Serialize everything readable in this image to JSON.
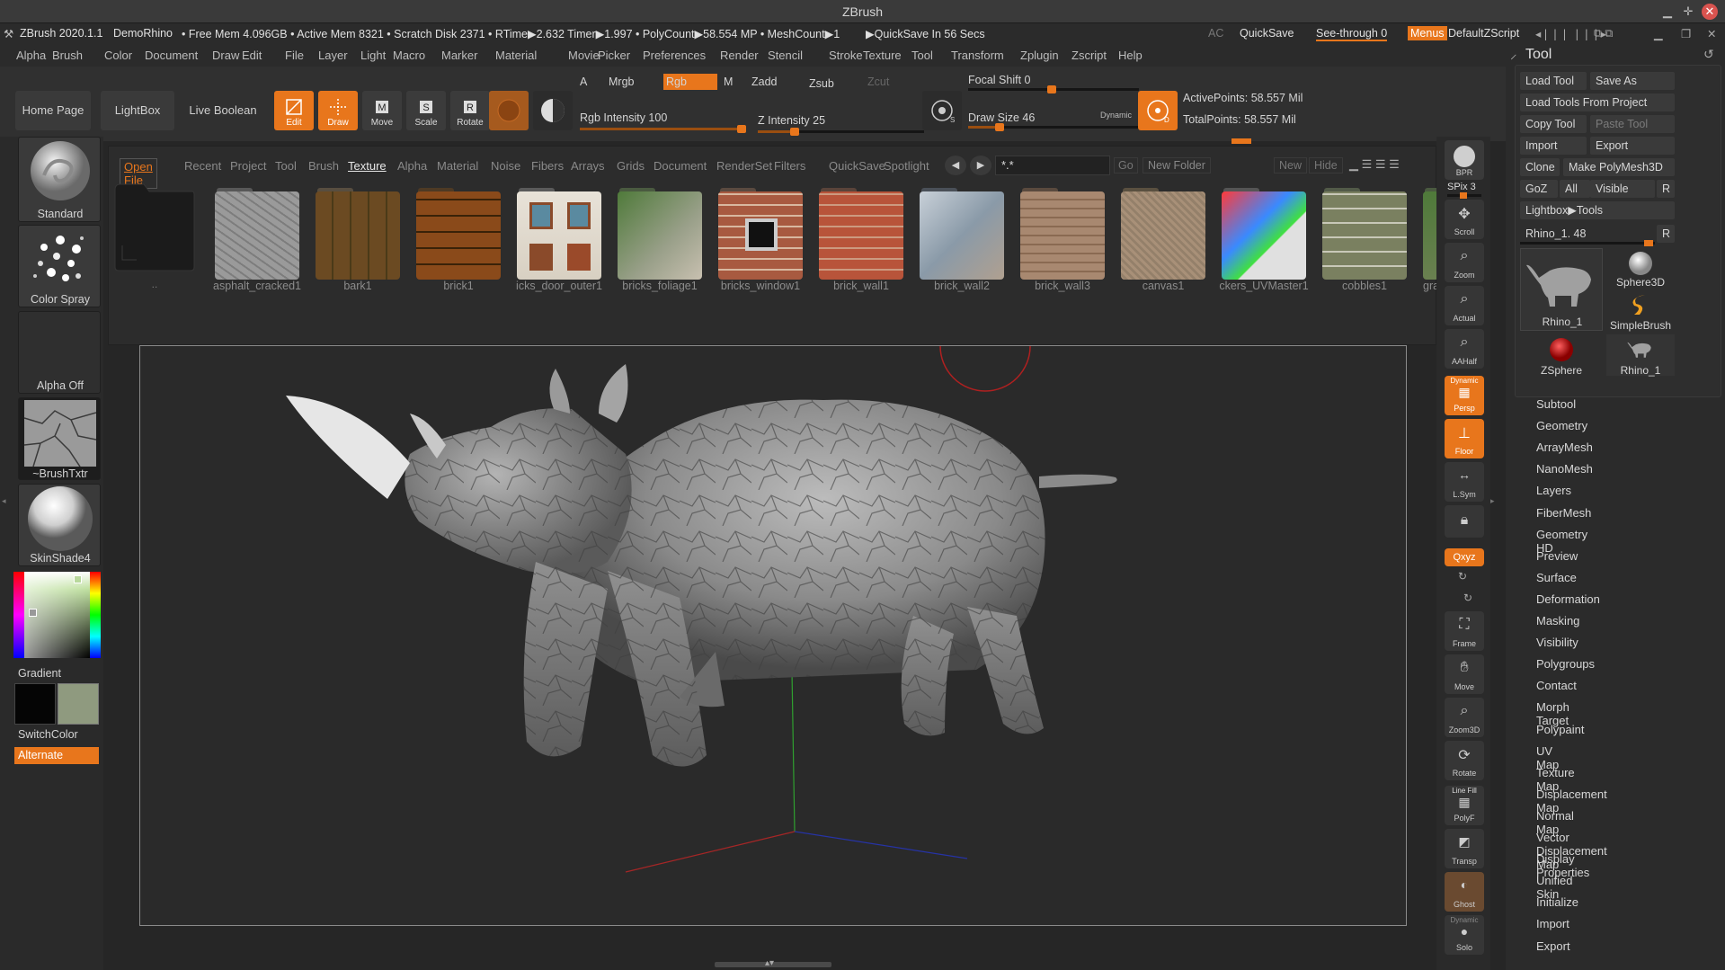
{
  "titlebar": {
    "title": "ZBrush"
  },
  "infobar": {
    "app": "ZBrush 2020.1.1",
    "doc": "DemoRhino",
    "stats": "• Free Mem 4.096GB • Active Mem 8321 • Scratch Disk 2371 • RTime▶2.632 Timer▶1.997 • PolyCount▶58.554 MP • MeshCount▶1",
    "quicksave_timer": "▶QuickSave In 56 Secs",
    "ac": "AC",
    "quicksave": "QuickSave",
    "seethrough": "See-through  0",
    "menus": "Menus",
    "script": "DefaultZScript"
  },
  "menubar": [
    "Alpha",
    "Brush",
    "Color",
    "Document",
    "Draw",
    "Edit",
    "File",
    "Layer",
    "Light",
    "Macro",
    "Marker",
    "Material",
    "Movie",
    "Picker",
    "Preferences",
    "Render",
    "Stencil",
    "Stroke",
    "Texture",
    "Tool",
    "Transform",
    "Zplugin",
    "Zscript",
    "Help"
  ],
  "topshelf": {
    "home": "Home Page",
    "lightbox": "LightBox",
    "liveboolean": "Live Boolean",
    "edit": "Edit",
    "draw": "Draw",
    "move": "Move",
    "scale": "Scale",
    "rotate": "Rotate",
    "a": "A",
    "mrgb": "Mrgb",
    "rgb": "Rgb",
    "m": "M",
    "zadd": "Zadd",
    "zsub": "Zsub",
    "zcut": "Zcut",
    "rgb_intensity": "Rgb Intensity 100",
    "z_intensity": "Z Intensity 25",
    "focal": "Focal Shift 0",
    "drawsize": "Draw Size 46",
    "dynamic": "Dynamic",
    "activepoints": "ActivePoints: 58.557 Mil",
    "totalpoints": "TotalPoints: 58.557 Mil",
    "rgb_intensity_value": 100,
    "z_intensity_value": 25
  },
  "leftpanel": {
    "standard": "Standard",
    "colorspray": "Color Spray",
    "alphaoff": "Alpha Off",
    "brushtxtr": "~BrushTxtr",
    "skinshade": "SkinShade4",
    "gradient": "Gradient",
    "switchcolor": "SwitchColor",
    "alternate": "Alternate"
  },
  "browser": {
    "tabs": [
      "Open File",
      "Recent",
      "Project",
      "Tool",
      "Brush",
      "Texture",
      "Alpha",
      "Material",
      "Noise",
      "Fibers",
      "Arrays",
      "Grids",
      "Document",
      "RenderSet",
      "Filters",
      "QuickSave",
      "Spotlight"
    ],
    "search": "*.*",
    "go": "Go",
    "newfolder": "New Folder",
    "new": "New",
    "hide": "Hide",
    "folder_label": "..",
    "items": [
      "asphalt_cracked1",
      "bark1",
      "brick1",
      "icks_door_outer1",
      "bricks_foliage1",
      "bricks_window1",
      "brick_wall1",
      "brick_wall2",
      "brick_wall3",
      "canvas1",
      "ckers_UVMaster1",
      "cobbles1",
      "gra"
    ]
  },
  "rightshelf": {
    "bpr": "BPR",
    "spix": "SPix 3",
    "scroll": "Scroll",
    "zoom": "Zoom",
    "actual": "Actual",
    "aahalf": "AAHalf",
    "dynamic": "Dynamic",
    "persp": "Persp",
    "floor": "Floor",
    "lsym": "L.Sym",
    "xyz": "Qxyz",
    "frame": "Frame",
    "move": "Move",
    "zoom3d": "Zoom3D",
    "rotate": "Rotate",
    "linefill": "Line Fill",
    "polyf": "PolyF",
    "transp": "Transp",
    "ghost": "Ghost",
    "solo": "Solo"
  },
  "toolpanel": {
    "title": "Tool",
    "loadtool": "Load Tool",
    "saveas": "Save As",
    "loadproject": "Load Tools From Project",
    "copytool": "Copy Tool",
    "pastetool": "Paste Tool",
    "import": "Import",
    "export": "Export",
    "clone": "Clone",
    "makepoly": "Make PolyMesh3D",
    "goz": "GoZ",
    "all": "All",
    "visible": "Visible",
    "r": "R",
    "lightboxtools": "Lightbox▶Tools",
    "rhino_slider": "Rhino_1. 48",
    "tools": [
      "Rhino_1",
      "Sphere3D",
      "SimpleBrush",
      "ZSphere",
      "Rhino_1"
    ],
    "sections": [
      "Subtool",
      "Geometry",
      "ArrayMesh",
      "NanoMesh",
      "Layers",
      "FiberMesh",
      "Geometry HD",
      "Preview",
      "Surface",
      "Deformation",
      "Masking",
      "Visibility",
      "Polygroups",
      "Contact",
      "Morph Target",
      "Polypaint",
      "UV Map",
      "Texture Map",
      "Displacement Map",
      "Normal Map",
      "Vector Displacement Map",
      "Display Properties",
      "Unified Skin",
      "Initialize",
      "Import",
      "Export"
    ]
  },
  "colors": {
    "accent": "#e8761c",
    "background": "#262626"
  }
}
